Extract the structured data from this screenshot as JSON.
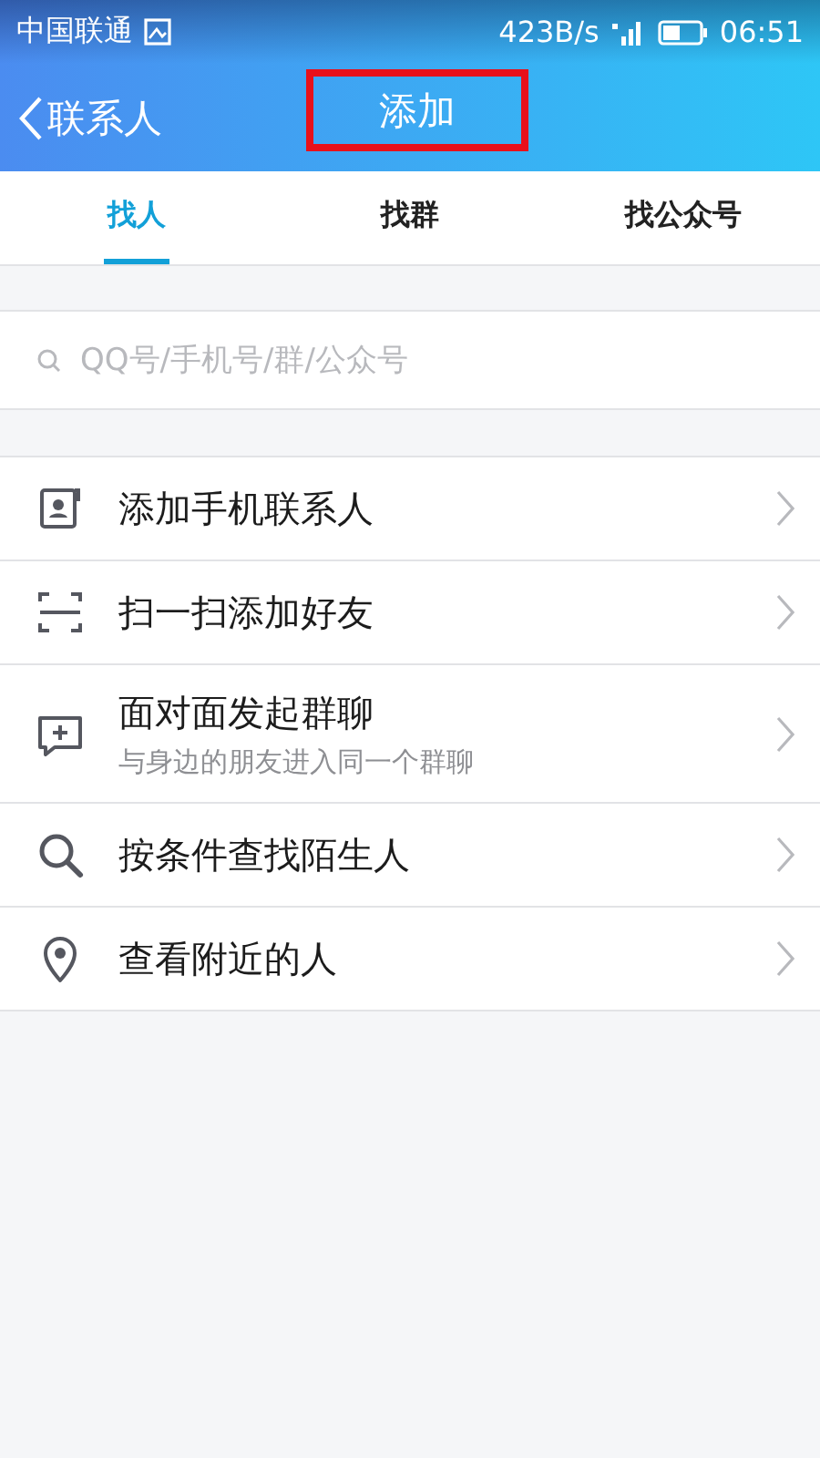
{
  "status_bar": {
    "carrier": "中国联通",
    "speed": "423B/s",
    "time": "06:51"
  },
  "header": {
    "back_label": "联系人",
    "title": "添加",
    "title_highlighted": true
  },
  "tabs": [
    {
      "label": "找人",
      "selected": true
    },
    {
      "label": "找群",
      "selected": false
    },
    {
      "label": "找公众号",
      "selected": false
    }
  ],
  "search": {
    "placeholder": "QQ号/手机号/群/公众号"
  },
  "items": [
    {
      "kind": "contact",
      "title": "添加手机联系人"
    },
    {
      "kind": "scan",
      "title": "扫一扫添加好友"
    },
    {
      "kind": "chat",
      "title": "面对面发起群聊",
      "subtitle": "与身边的朋友进入同一个群聊"
    },
    {
      "kind": "search",
      "title": "按条件查找陌生人"
    },
    {
      "kind": "location",
      "title": "查看附近的人"
    }
  ]
}
